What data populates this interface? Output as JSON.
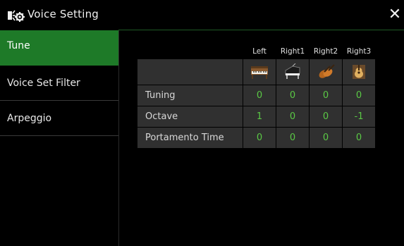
{
  "header": {
    "title": "Voice Setting",
    "close_icon": "close-icon",
    "app_icon": "voice-setting-icon"
  },
  "sidebar": {
    "items": [
      {
        "label": "Tune",
        "active": true
      },
      {
        "label": "Voice Set Filter",
        "active": false
      },
      {
        "label": "Arpeggio",
        "active": false
      }
    ]
  },
  "table": {
    "columns": [
      {
        "label": "Left",
        "icon": "organ-icon"
      },
      {
        "label": "Right1",
        "icon": "grand-piano-icon"
      },
      {
        "label": "Right2",
        "icon": "strings-icon"
      },
      {
        "label": "Right3",
        "icon": "acoustic-guitar-icon"
      }
    ],
    "rows": [
      {
        "label": "Tuning",
        "values": [
          "0",
          "0",
          "0",
          "0"
        ]
      },
      {
        "label": "Octave",
        "values": [
          "1",
          "0",
          "0",
          "-1"
        ]
      },
      {
        "label": "Portamento Time",
        "values": [
          "0",
          "0",
          "0",
          "0"
        ]
      }
    ]
  },
  "colors": {
    "accent": "#1e7a28",
    "value_text": "#5ac845",
    "cell_bg": "#303030"
  }
}
